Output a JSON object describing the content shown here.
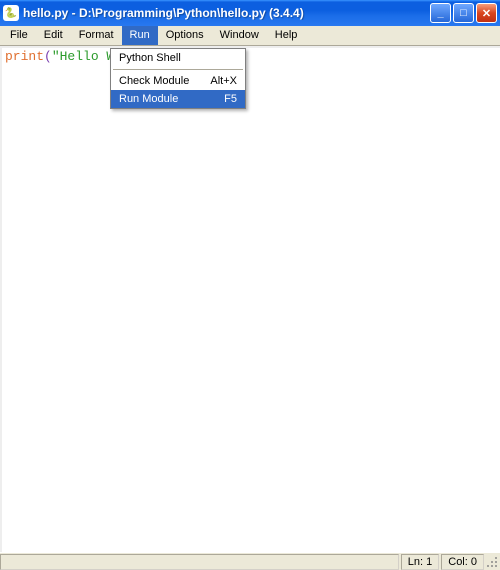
{
  "title": "hello.py - D:\\Programming\\Python\\hello.py (3.4.4)",
  "menus": {
    "file": "File",
    "edit": "Edit",
    "format": "Format",
    "run": "Run",
    "options": "Options",
    "window": "Window",
    "help": "Help"
  },
  "run_menu": {
    "python_shell": {
      "label": "Python Shell",
      "shortcut": ""
    },
    "check_module": {
      "label": "Check Module",
      "shortcut": "Alt+X"
    },
    "run_module": {
      "label": "Run Module",
      "shortcut": "F5"
    }
  },
  "code": {
    "keyword": "print",
    "paren_open": "(",
    "string": "\"Hello W"
  },
  "status": {
    "line": "Ln: 1",
    "col": "Col: 0"
  },
  "icons": {
    "app": "🐍",
    "min": "_",
    "max": "□",
    "close": "✕"
  }
}
